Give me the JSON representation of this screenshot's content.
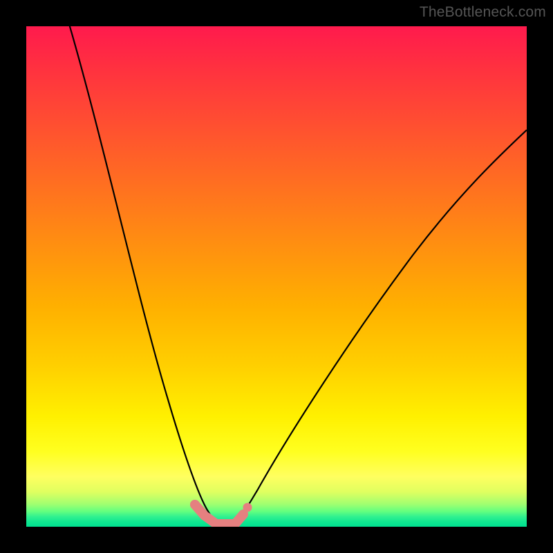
{
  "watermark": "TheBottleneck.com",
  "colors": {
    "frame_background": "#000000",
    "gradient_top": "#ff1a4d",
    "gradient_bottom": "#00e090",
    "curve_stroke": "#000000",
    "marker": "#e58080"
  },
  "chart_data": {
    "type": "line",
    "title": "",
    "xlabel": "",
    "ylabel": "",
    "xlim": [
      0,
      100
    ],
    "ylim": [
      0,
      100
    ],
    "grid": false,
    "series": [
      {
        "name": "left-curve",
        "x": [
          0,
          2,
          4,
          6,
          8,
          10,
          12,
          14,
          16,
          18,
          20,
          22,
          24,
          26,
          28,
          30,
          31,
          32,
          33,
          34,
          35,
          36,
          37
        ],
        "values": [
          100,
          96,
          91,
          86,
          80,
          74,
          67,
          60,
          53,
          46,
          39,
          32,
          25,
          19,
          13,
          8,
          6,
          4,
          3,
          2,
          1.2,
          0.6,
          0.3
        ]
      },
      {
        "name": "right-curve",
        "x": [
          40,
          41,
          42,
          44,
          46,
          48,
          50,
          54,
          58,
          62,
          66,
          70,
          74,
          78,
          82,
          86,
          90,
          94,
          98,
          100
        ],
        "values": [
          0.3,
          0.8,
          1.5,
          3,
          5,
          8,
          11,
          17,
          23,
          29,
          35,
          41,
          47,
          53,
          59,
          64,
          69,
          73,
          77,
          79
        ]
      }
    ],
    "flat_region": {
      "x_start": 37,
      "x_end": 40,
      "value": 0.3
    },
    "marker_points": [
      {
        "x": 32.5,
        "y": 3.0,
        "type": "segment-start"
      },
      {
        "x": 35.0,
        "y": 1.0,
        "type": "segment-mid"
      },
      {
        "x": 37.0,
        "y": 0.3,
        "type": "segment-end-left"
      },
      {
        "x": 40.0,
        "y": 0.3,
        "type": "segment-end-right"
      },
      {
        "x": 41.5,
        "y": 1.5,
        "type": "dot"
      },
      {
        "x": 43.0,
        "y": 3.0,
        "type": "dot"
      }
    ]
  }
}
